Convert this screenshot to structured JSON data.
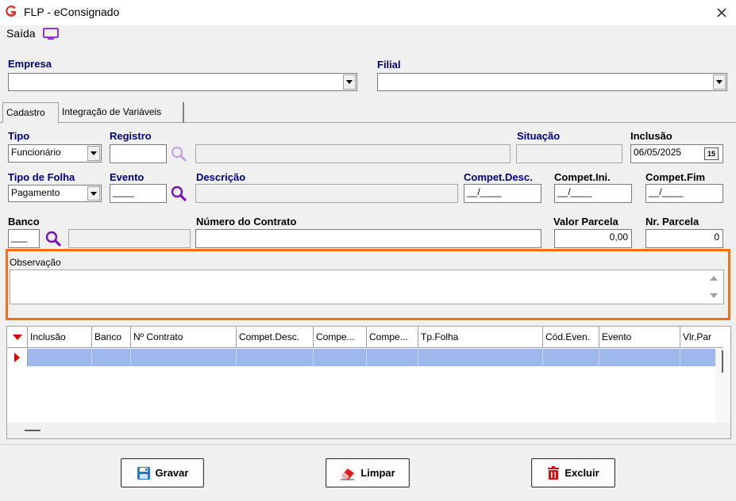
{
  "window": {
    "title": "FLP - eConsignado",
    "close_glyph": "✕"
  },
  "menu": {
    "saida": "Saída"
  },
  "header": {
    "empresa_label": "Empresa",
    "empresa_value": "",
    "filial_label": "Filial",
    "filial_value": ""
  },
  "tabs": [
    {
      "label": "Cadastro"
    },
    {
      "label": "Integração de Variáveis"
    }
  ],
  "form": {
    "tipo_label": "Tipo",
    "tipo_value": "Funcionário",
    "registro_label": "Registro",
    "registro_value": "",
    "registro_desc": "",
    "situacao_label": "Situação",
    "situacao_value": "",
    "inclusao_label": "Inclusão",
    "inclusao_value": "06/05/2025",
    "inclusao_btn": "15",
    "tipo_folha_label": "Tipo de Folha",
    "tipo_folha_value": "Pagamento",
    "evento_label": "Evento",
    "evento_value": "____",
    "descricao_label": "Descrição",
    "descricao_value": "",
    "compet_desc_label": "Compet.Desc.",
    "compet_desc_value": "__/____",
    "compet_ini_label": "Compet.Ini.",
    "compet_ini_value": "__/____",
    "compet_fim_label": "Compet.Fim",
    "compet_fim_value": "__/____",
    "banco_label": "Banco",
    "banco_value": "___",
    "banco_desc": "",
    "numero_contrato_label": "Número do Contrato",
    "numero_contrato_value": "",
    "valor_parcela_label": "Valor Parcela",
    "valor_parcela_value": "0,00",
    "nr_parcela_label": "Nr. Parcela",
    "nr_parcela_value": "0",
    "observacao_label": "Observação",
    "observacao_value": ""
  },
  "grid": {
    "columns": [
      "Inclusão",
      "Banco",
      "Nº Contrato",
      "Compet.Desc.",
      "Compe...",
      "Compe...",
      "Tp.Folha",
      "Cód.Even.",
      "Evento",
      "Vlr.Par"
    ]
  },
  "buttons": {
    "gravar": "Gravar",
    "limpar": "Limpar",
    "excluir": "Excluir"
  },
  "colors": {
    "label": "#000080",
    "highlight": "#ff6a13",
    "selected_row": "#9fb8ec",
    "icon_purple": "#9b30d9"
  }
}
